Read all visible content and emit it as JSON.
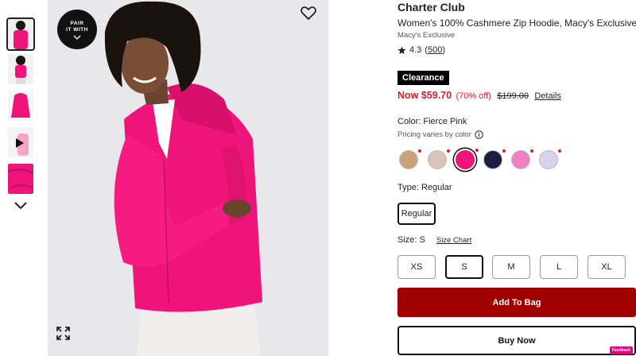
{
  "gallery": {
    "pair_label_1": "PAIR",
    "pair_label_2": "IT WITH"
  },
  "product": {
    "brand": "Charter Club",
    "name": "Women's 100% Cashmere Zip Hoodie, Macy's Exclusive",
    "exclusive": "Macy's Exclusive",
    "rating": "4.3",
    "review_count": "500"
  },
  "pricing": {
    "badge": "Clearance",
    "now": "Now $59.70",
    "percent_off": "(70% off)",
    "original": "$199.00",
    "details_link": "Details"
  },
  "color": {
    "label": "Color: Fierce Pink",
    "pricing_note": "Pricing varies by color",
    "swatches": [
      {
        "name": "tan",
        "hex": "#c9a27c",
        "selected": false,
        "sale_dot": true
      },
      {
        "name": "light-heather",
        "hex": "#d8c4b8",
        "selected": false,
        "sale_dot": true
      },
      {
        "name": "fierce-pink",
        "hex": "#ef147a",
        "selected": true,
        "sale_dot": true
      },
      {
        "name": "navy",
        "hex": "#1b1d44",
        "selected": false,
        "sale_dot": true
      },
      {
        "name": "light-pink",
        "hex": "#f07fc6",
        "selected": false,
        "sale_dot": true
      },
      {
        "name": "lavender",
        "hex": "#d9d2ee",
        "selected": false,
        "sale_dot": true
      }
    ]
  },
  "type": {
    "label": "Type: Regular",
    "options": [
      "Regular"
    ]
  },
  "size": {
    "label": "Size: S",
    "chart_link": "Size Chart",
    "options": [
      {
        "label": "XS",
        "selected": false
      },
      {
        "label": "S",
        "selected": true
      },
      {
        "label": "M",
        "selected": false
      },
      {
        "label": "L",
        "selected": false
      },
      {
        "label": "XL",
        "selected": false
      }
    ]
  },
  "actions": {
    "add_to_bag": "Add To Bag",
    "buy_now": "Buy Now"
  },
  "feedback_badge": "Feedback",
  "colors": {
    "sale_red": "#e21a2c",
    "bag_button": "#a00000",
    "hoodie_pink": "#ef147a"
  }
}
